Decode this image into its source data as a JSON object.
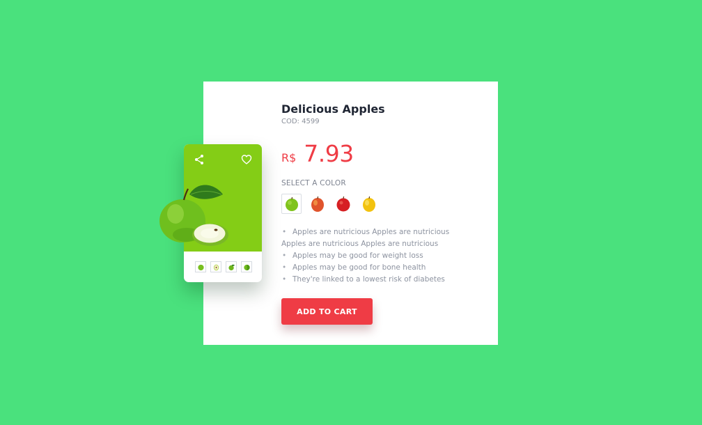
{
  "product": {
    "title": "Delicious Apples",
    "code": "COD: 4599",
    "currency": "R$",
    "price": "7.93"
  },
  "color_selector": {
    "label": "SELECT A COLOR",
    "options": [
      {
        "name": "green-apple",
        "color": "#7fc31c",
        "selected": true
      },
      {
        "name": "orange-red-apple",
        "color": "#e0542c",
        "selected": false
      },
      {
        "name": "red-apple",
        "color": "#d61f23",
        "selected": false
      },
      {
        "name": "yellow-apple",
        "color": "#f2c20f",
        "selected": false
      }
    ]
  },
  "features": [
    "Apples are nutricious Apples are nutricious Apples are nutricious Apples are nutricious",
    "Apples may be good for weight loss",
    "Apples may be good for bone health",
    "They're linked to a lowest risk of diabetes"
  ],
  "cta": {
    "label": "ADD TO CART"
  },
  "image_panel": {
    "background": "#84cd16",
    "icons": [
      "share-icon",
      "heart-icon"
    ],
    "thumbnail_count": 4
  },
  "colors": {
    "page_background": "#4ae17d",
    "accent": "#ef3c45",
    "title_text": "#1f2533",
    "muted_text": "#8d93a0"
  }
}
